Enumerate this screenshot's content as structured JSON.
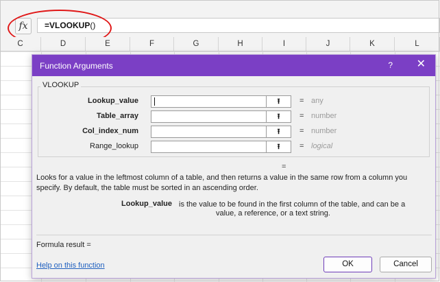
{
  "formula_bar": {
    "fx_label": "fx",
    "formula_name": "=VLOOKUP",
    "formula_parens": "()"
  },
  "columns": [
    "C",
    "D",
    "E",
    "F",
    "G",
    "H",
    "I",
    "J",
    "K",
    "L"
  ],
  "dialog": {
    "title": "Function Arguments",
    "help_label": "?",
    "close_label": "✕",
    "group_label": "VLOOKUP",
    "arguments": [
      {
        "label": "Lookup_value",
        "bold": true,
        "value": "",
        "equals": "=",
        "result": "any"
      },
      {
        "label": "Table_array",
        "bold": true,
        "value": "",
        "equals": "=",
        "result": "number"
      },
      {
        "label": "Col_index_num",
        "bold": true,
        "value": "",
        "equals": "=",
        "result": "number"
      },
      {
        "label": "Range_lookup",
        "bold": false,
        "value": "",
        "equals": "=",
        "result": "logical"
      }
    ],
    "collapse_icon": "⭱",
    "function_result_equals": "=",
    "description": "Looks for a value in the leftmost column of a table, and then returns a value in the same row from a column you specify. By default, the table must be sorted in an ascending order.",
    "arg_help_name": "Lookup_value",
    "arg_help_text_line1": "is the value to be found in the first column of the table, and can be a",
    "arg_help_text_line2": "value, a reference, or a text string.",
    "formula_result_label": "Formula result =",
    "help_link": "Help on this function",
    "ok_label": "OK",
    "cancel_label": "Cancel"
  },
  "colors": {
    "title_bar": "#7b3fc5",
    "annotation_circle": "#e01717",
    "link": "#1e5fbf"
  }
}
